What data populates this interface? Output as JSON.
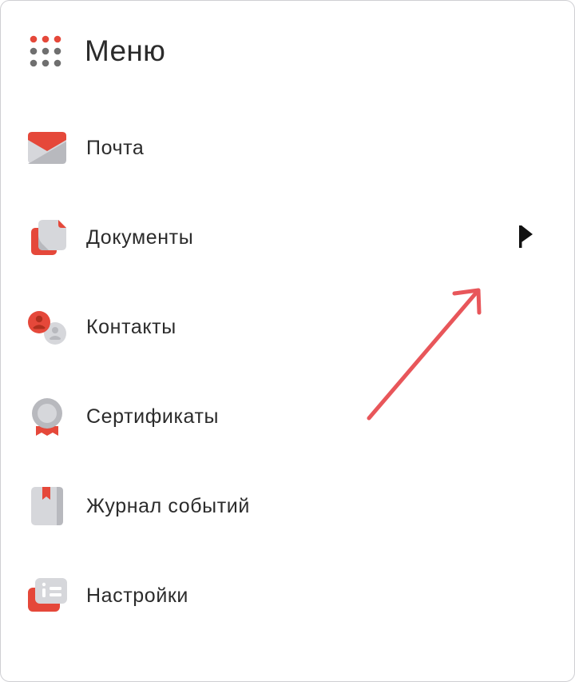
{
  "menu": {
    "title": "Меню",
    "items": [
      {
        "id": "mail",
        "label": "Почта",
        "icon": "mail-icon"
      },
      {
        "id": "documents",
        "label": "Документы",
        "icon": "documents-icon"
      },
      {
        "id": "contacts",
        "label": "Контакты",
        "icon": "contacts-icon"
      },
      {
        "id": "certificates",
        "label": "Сертификаты",
        "icon": "certificate-icon"
      },
      {
        "id": "events-log",
        "label": "Журнал событий",
        "icon": "journal-icon"
      },
      {
        "id": "settings",
        "label": "Настройки",
        "icon": "settings-icon"
      }
    ]
  },
  "colors": {
    "accent_red": "#e5483a",
    "icon_gray": "#d6d7db",
    "icon_gray_dark": "#b8b9be",
    "dot_gray": "#6f6f6f",
    "annotation_arrow": "#e8565a",
    "flag": "#111111"
  }
}
